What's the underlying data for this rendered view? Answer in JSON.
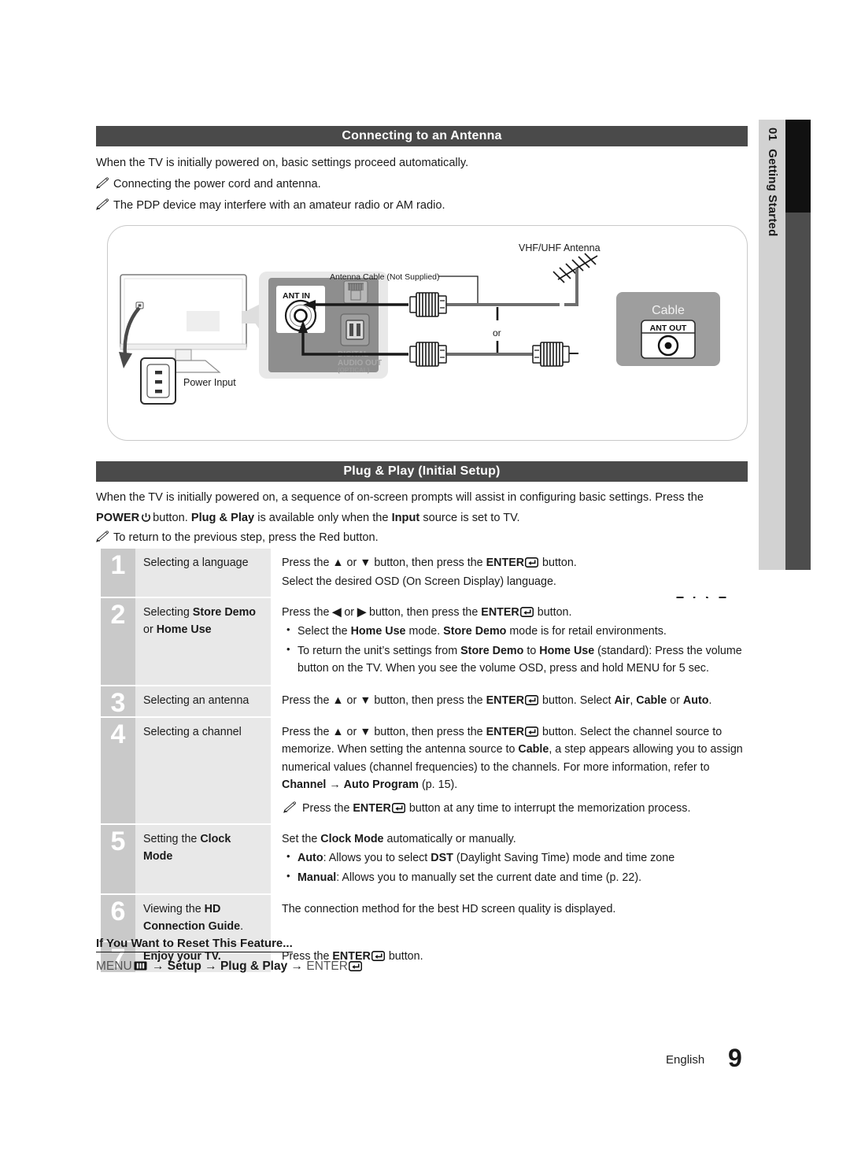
{
  "sidebar": {
    "chapter_number": "01",
    "chapter_title": "Getting Started"
  },
  "section1": {
    "heading": "Connecting to an Antenna",
    "intro": "When the TV is initially powered on, basic settings proceed automatically.",
    "notes": [
      "Connecting the power cord and antenna.",
      "The PDP device may interfere with an amateur radio or AM radio."
    ],
    "diagram": {
      "antenna_label": "VHF/UHF Antenna",
      "cable_label": "Antenna Cable (Not Supplied)",
      "or_label": "or",
      "ant_in_label": "ANT IN",
      "ant_out_label": "ANT OUT",
      "cable_box_label": "Cable",
      "power_input_label": "Power Input",
      "port_text_line1": "DIGITAL",
      "port_text_line2": "AUDIO OUT",
      "port_text_line3": "(OPTICAL)"
    }
  },
  "section2": {
    "heading": "Plug & Play (Initial Setup)",
    "intro_a": "When the TV is initially powered on, a sequence of on-screen prompts will assist in configuring basic settings. Press the",
    "intro_power": "POWER",
    "intro_b": "button.",
    "intro_pp": "Plug & Play",
    "intro_c": "is available only when the",
    "intro_input": "Input",
    "intro_d": "source is set to TV.",
    "note": "To return to the previous step, press the Red button.",
    "power_label": "POWER"
  },
  "steps": [
    {
      "number": "1",
      "label_plain": "Selecting a language",
      "lines": [
        "Press the ▲ or ▼ button, then press the ENTER button.",
        "Select the desired OSD (On Screen Display) language."
      ]
    },
    {
      "number": "2",
      "label_a": "Selecting ",
      "label_b": "Store Demo",
      "label_c": "or ",
      "label_d": "Home Use",
      "line1": "Press the ◀ or ▶ button, then press the ENTER button.",
      "bullets": [
        "Select the Home Use mode. Store Demo mode is for retail environments.",
        "To return the unit's settings from Store Demo to Home Use (standard): Press the volume button on the TV. When you see the volume OSD, press and hold MENU for 5 sec."
      ]
    },
    {
      "number": "3",
      "label_plain": "Selecting an antenna",
      "line1": "Press the ▲ or ▼ button, then press the ENTER button. Select Air, Cable or Auto."
    },
    {
      "number": "4",
      "label_plain": "Selecting a channel",
      "line1": "Press the ▲ or ▼ button, then press the ENTER button. Select the channel source to memorize. When setting the antenna source to Cable, a step appears allowing you to assign numerical values (channel frequencies) to the channels. For more information, refer to Channel → Auto Program (p. 15).",
      "note": "Press the ENTER button at any time to interrupt the memorization process."
    },
    {
      "number": "5",
      "label_a": "Setting the ",
      "label_b": "Clock",
      "label_c": "Mode",
      "line1": "Set the Clock Mode automatically or manually.",
      "bullets": [
        "Auto: Allows you to select DST (Daylight Saving Time) mode and time zone",
        "Manual: Allows you to manually set the current date and time (p. 22)."
      ]
    },
    {
      "number": "6",
      "label_a": "Viewing the ",
      "label_b": "HD",
      "label_c": "Connection Guide",
      "label_d": ".",
      "line1": "The connection method for the best HD screen quality is displayed."
    },
    {
      "number": "7",
      "label_bold": "Enjoy your TV.",
      "line1": "Press the ENTER button."
    }
  ],
  "reset": {
    "title": "If You Want to Reset This Feature...",
    "menu_word": "MENU",
    "arrow": "→",
    "setup": "Setup",
    "plug_play": "Plug & Play",
    "enter_word": "ENTER"
  },
  "footer": {
    "language": "English",
    "page_number": "9"
  },
  "colors": {
    "header_bar": "#4a4a4a",
    "step_number_col": "#c9c9c9",
    "step_label_col": "#e8e8e8",
    "sidetab": "#d2d2d2",
    "siderail_dark": "#111111",
    "siderail_mid": "#4d4d4d"
  }
}
